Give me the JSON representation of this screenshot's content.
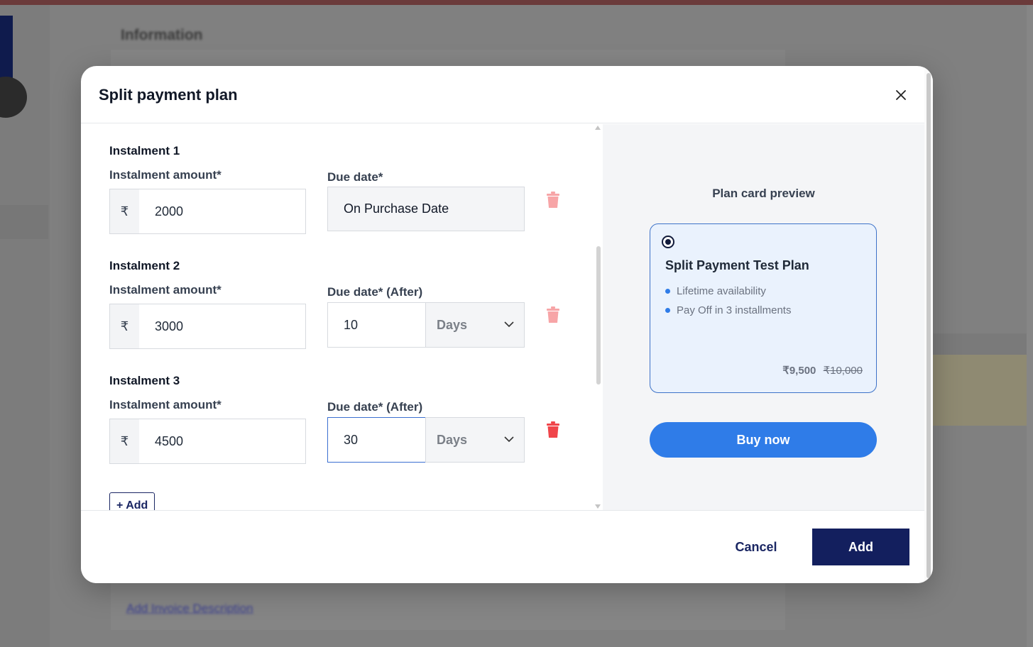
{
  "background": {
    "heading": "Information",
    "link": "Add Invoice Description"
  },
  "modal": {
    "title": "Split payment plan",
    "close_icon": "close-icon"
  },
  "instalments": [
    {
      "title": "Instalment 1",
      "amount_label": "Instalment amount*",
      "currency": "₹",
      "amount": "2000",
      "due_label": "Due date*",
      "due_value": "On Purchase Date",
      "delete_icon": "trash-icon",
      "delete_enabled": false
    },
    {
      "title": "Instalment 2",
      "amount_label": "Instalment amount*",
      "currency": "₹",
      "amount": "3000",
      "due_label": "Due date* (After)",
      "due_days": "10",
      "due_unit": "Days",
      "delete_icon": "trash-icon",
      "delete_enabled": false
    },
    {
      "title": "Instalment 3",
      "amount_label": "Instalment amount*",
      "currency": "₹",
      "amount": "4500",
      "due_label": "Due date* (After)",
      "due_days": "30",
      "due_unit": "Days",
      "delete_icon": "trash-icon",
      "delete_enabled": true
    }
  ],
  "add_instalment_label": "+ Add",
  "preview": {
    "title": "Plan card preview",
    "plan_name": "Split Payment Test Plan",
    "features": [
      "Lifetime availability",
      "Pay Off in 3 installments"
    ],
    "price_now": "₹9,500",
    "price_was": "₹10,000",
    "buy_label": "Buy now"
  },
  "footer": {
    "cancel_label": "Cancel",
    "add_label": "Add"
  },
  "colors": {
    "primary": "#131f5e",
    "accent": "#2f7ce8",
    "danger": "#f0454a",
    "danger_disabled": "#f7a5a7"
  }
}
